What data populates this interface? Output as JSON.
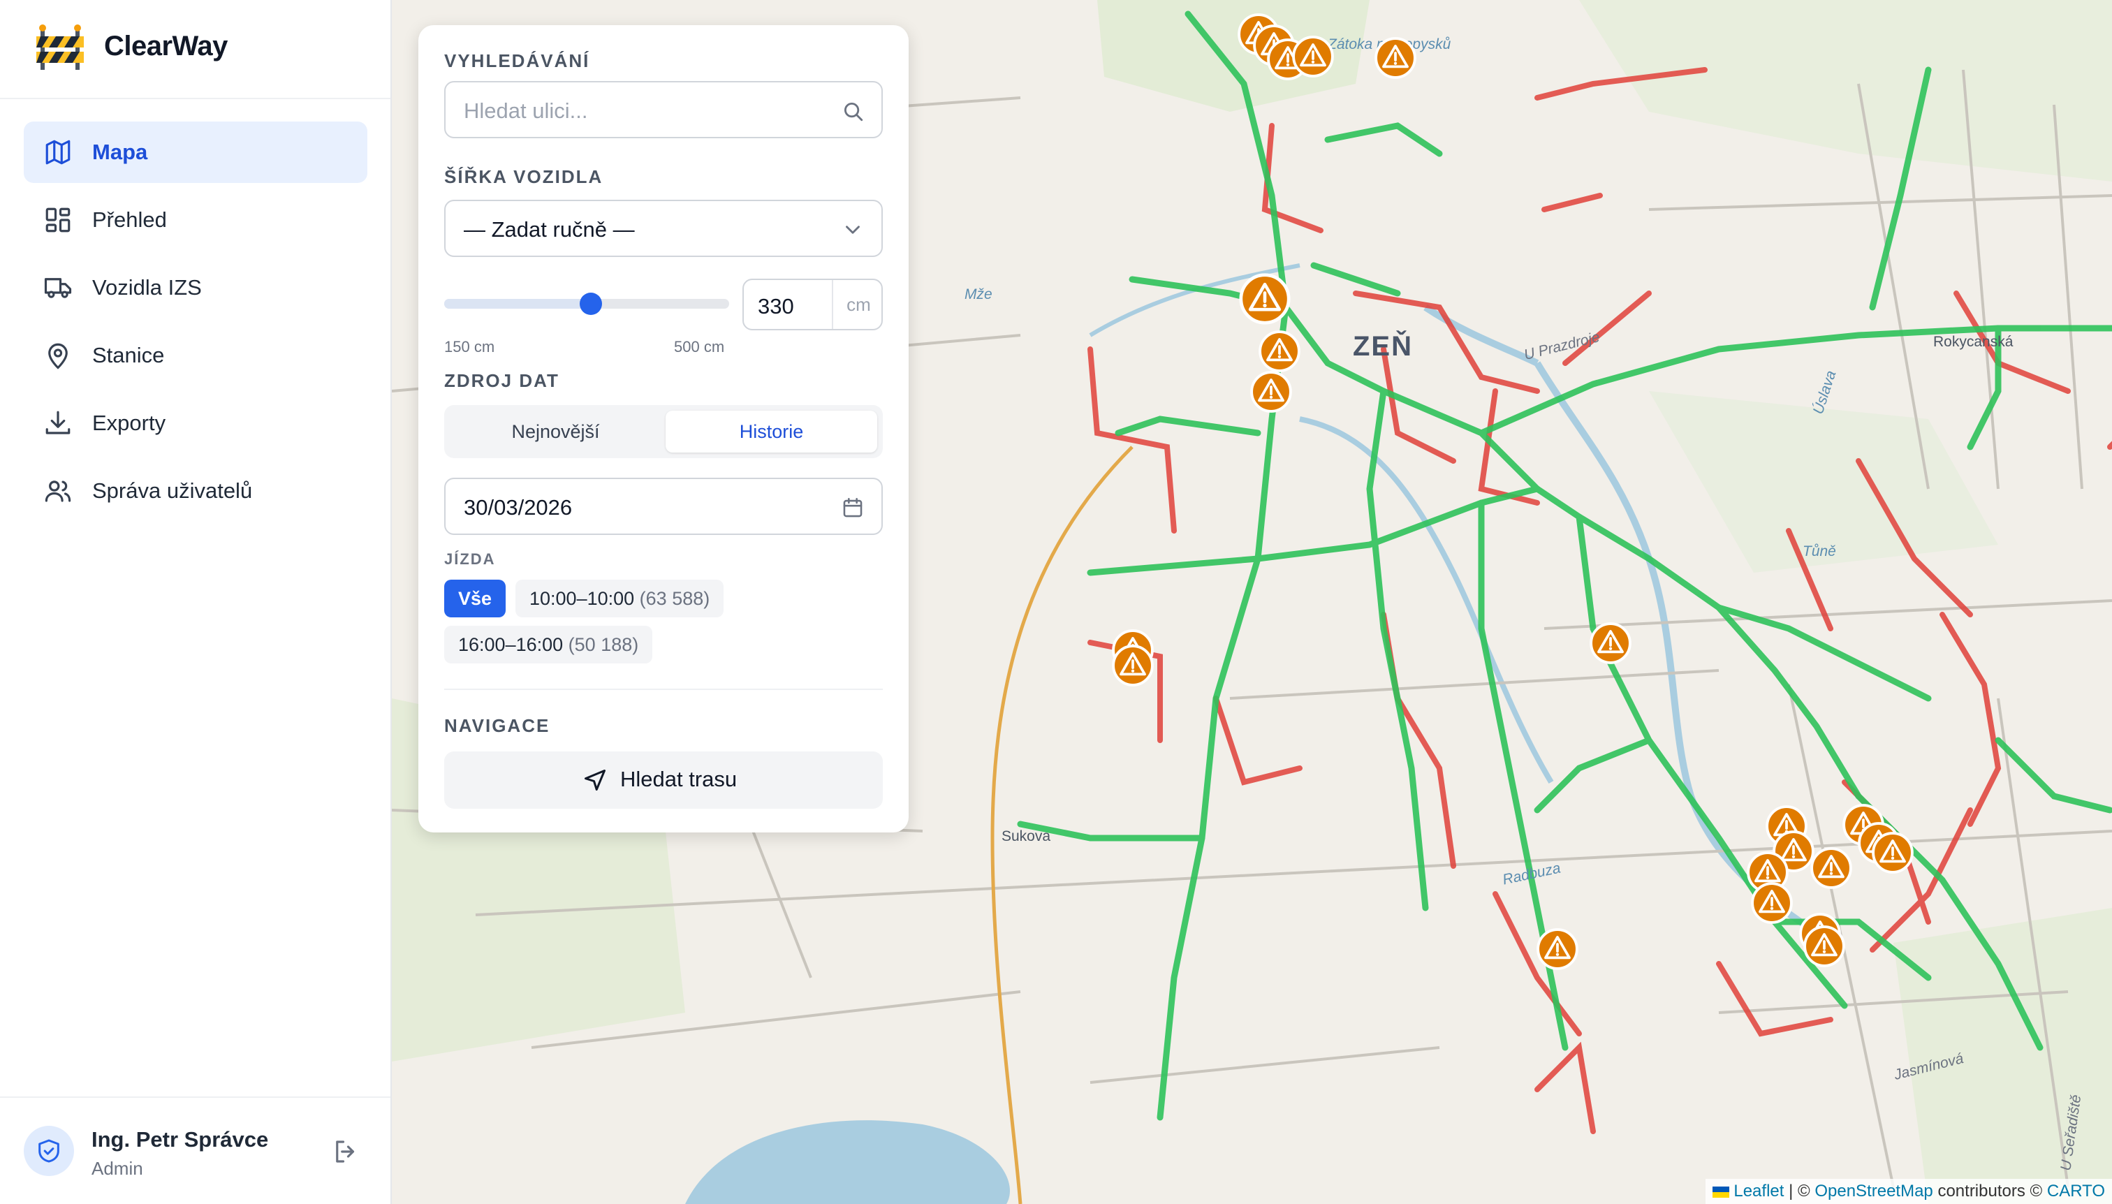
{
  "app": {
    "name": "ClearWay"
  },
  "sidebar": {
    "items": [
      {
        "label": "Mapa",
        "icon": "map-icon",
        "active": true
      },
      {
        "label": "Přehled",
        "icon": "dashboard-icon",
        "active": false
      },
      {
        "label": "Vozidla IZS",
        "icon": "truck-icon",
        "active": false
      },
      {
        "label": "Stanice",
        "icon": "map-pin-icon",
        "active": false
      },
      {
        "label": "Exporty",
        "icon": "download-icon",
        "active": false
      },
      {
        "label": "Správa uživatelů",
        "icon": "users-icon",
        "active": false
      }
    ]
  },
  "user": {
    "name": "Ing. Petr Správce",
    "role": "Admin"
  },
  "panel": {
    "search": {
      "label": "VYHLEDÁVÁNÍ",
      "placeholder": "Hledat ulici..."
    },
    "vehicle_width": {
      "label": "ŠÍŘKA VOZIDLA",
      "select_value": "— Zadat ručně —",
      "min_label": "150 cm",
      "max_label": "500 cm",
      "min": 150,
      "max": 500,
      "value": 330,
      "value_text": "330",
      "unit": "cm"
    },
    "data_source": {
      "label": "ZDROJ DAT",
      "options": [
        "Nejnovější",
        "Historie"
      ],
      "active_option": "Historie"
    },
    "date": {
      "value": "30/03/2026"
    },
    "ride": {
      "label": "JÍZDA",
      "options": [
        {
          "label": "Vše",
          "count": "",
          "active": true
        },
        {
          "label": "10:00–10:00",
          "count": "(63 588)",
          "active": false
        },
        {
          "label": "16:00–16:00",
          "count": "(50 188)",
          "active": false
        }
      ]
    },
    "navigation": {
      "label": "NAVIGACE",
      "button_label": "Hledat trasu"
    }
  },
  "map": {
    "city_label": "ZEŇ",
    "street_labels": [
      "Sukova",
      "Rokycanská",
      "Jasmínová",
      "Radbuza",
      "Mže",
      "Úslava",
      "Zátoka ptakopysků",
      "Tůně",
      "U Prazdroje",
      "U Seřadiště"
    ],
    "colors": {
      "passable": "#2fc25b",
      "impassable": "#e0413a",
      "warning_marker": "#e07b00",
      "water": "#a9cde0",
      "accent": "#2563eb"
    },
    "attribution": {
      "leaflet": "Leaflet",
      "separator": " | © ",
      "osm": "OpenStreetMap",
      "contrib": " contributors © ",
      "carto": "CARTO"
    }
  }
}
